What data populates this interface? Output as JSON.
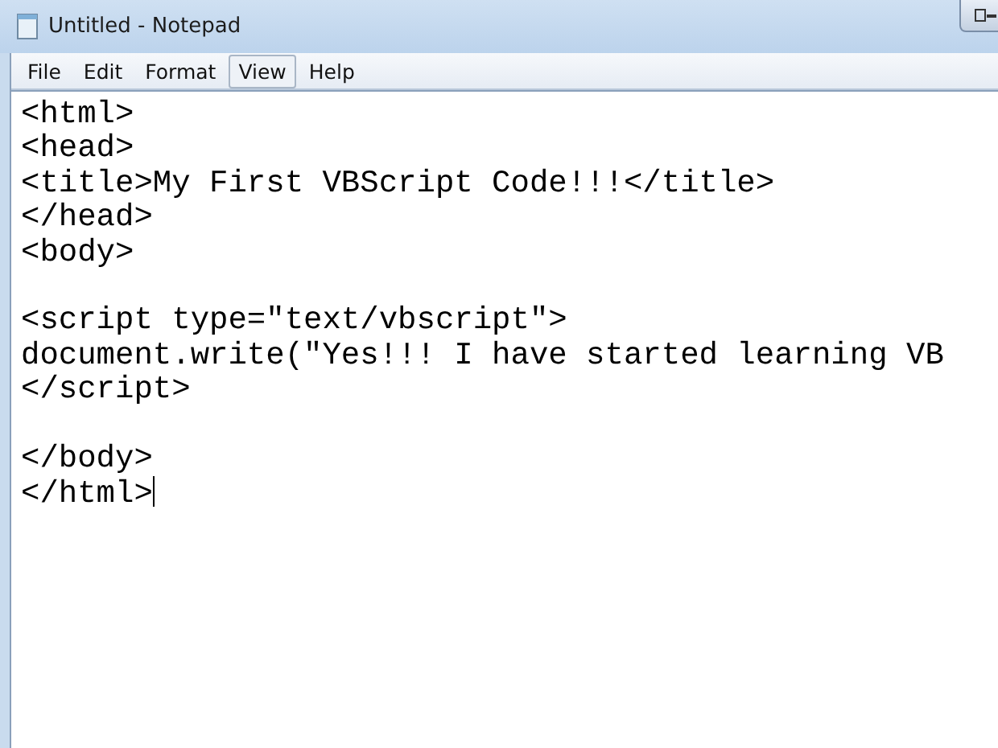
{
  "window": {
    "title": "Untitled - Notepad"
  },
  "menu": [
    {
      "label": "File",
      "selected": false
    },
    {
      "label": "Edit",
      "selected": false
    },
    {
      "label": "Format",
      "selected": false
    },
    {
      "label": "View",
      "selected": true
    },
    {
      "label": "Help",
      "selected": false
    }
  ],
  "editor": {
    "blocks": [
      [
        "<html>",
        "<head>",
        "<title>My First VBScript Code!!!</title>",
        "</head>",
        "<body>"
      ],
      [
        "<script type=\"text/vbscript\">",
        "document.write(\"Yes!!! I have started learning VB",
        "</script>"
      ],
      [
        "</body>",
        "</html>"
      ]
    ],
    "caret": true
  }
}
